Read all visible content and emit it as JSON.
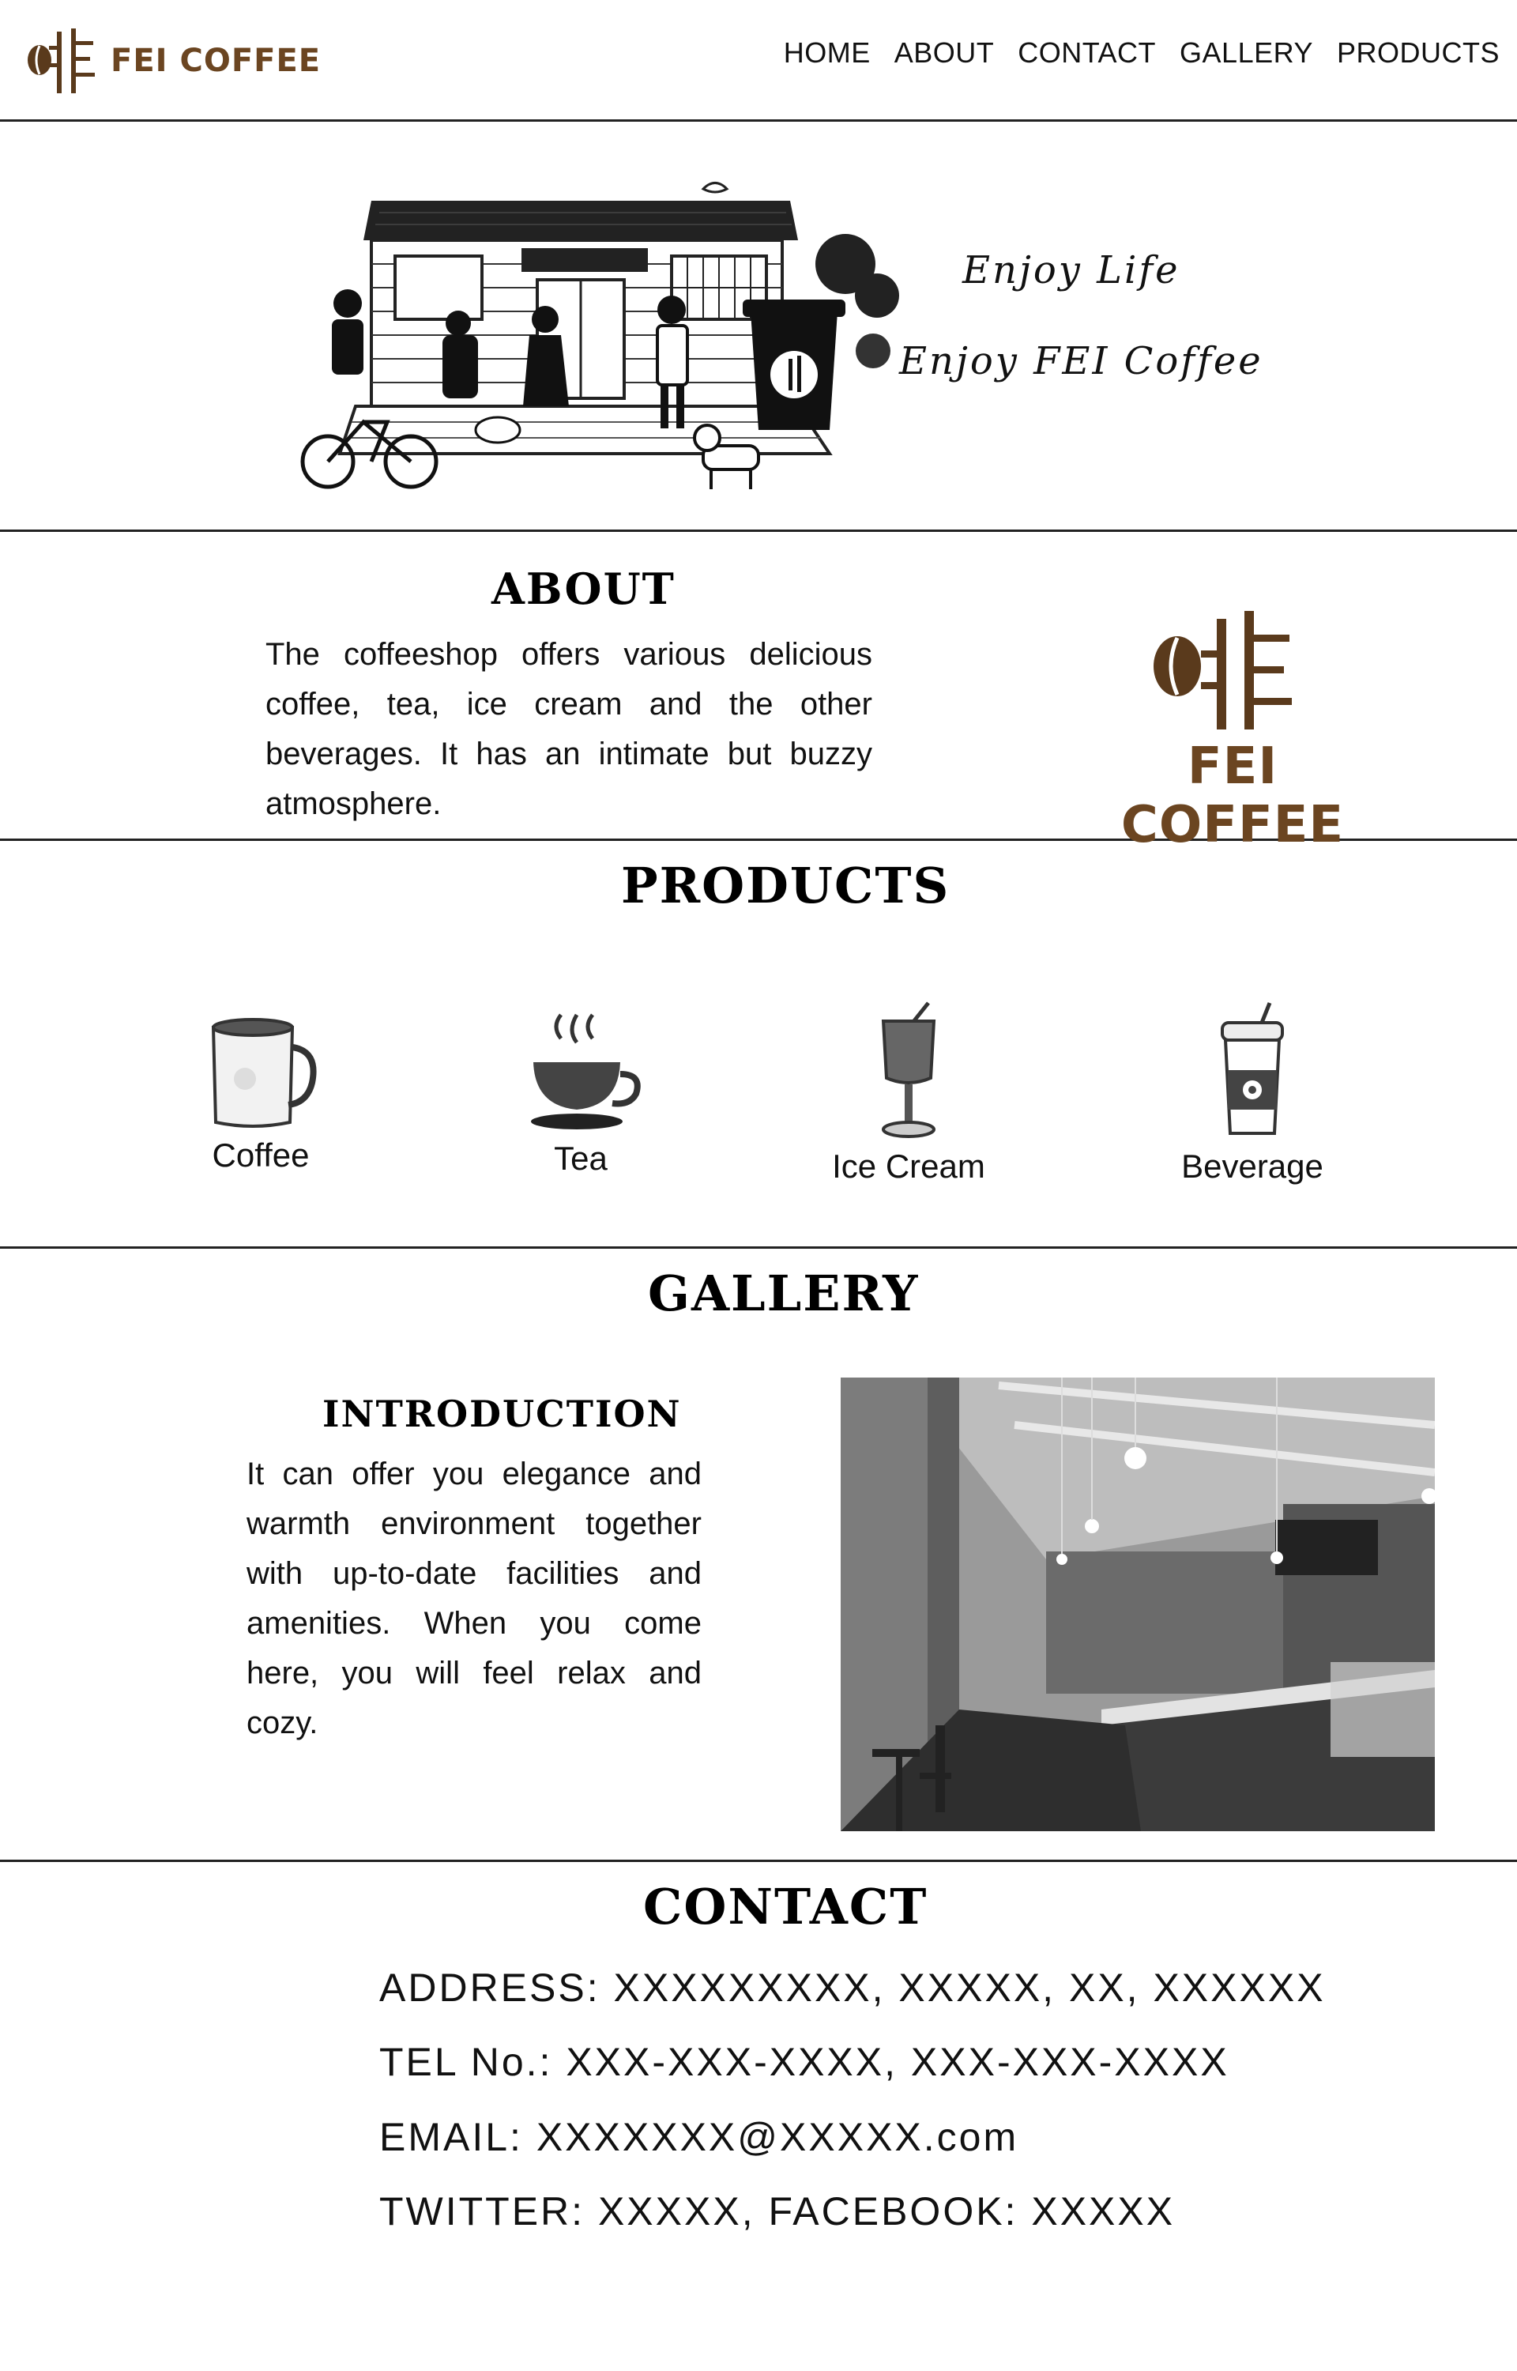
{
  "brand": {
    "name": "FEI COFFEE",
    "color": "#6b4521"
  },
  "nav": {
    "items": [
      "HOME",
      "ABOUT",
      "CONTACT",
      "GALLERY",
      "PRODUCTS"
    ]
  },
  "hero": {
    "slogans": [
      "Enjoy Life",
      "Enjoy FEI Coffee"
    ]
  },
  "about": {
    "title": "ABOUT",
    "text": "The coffeeshop offers various delicious coffee, tea, ice cream and the other beverages. It has an intimate but buzzy atmosphere."
  },
  "products": {
    "title": "PRODUCTS",
    "items": [
      {
        "label": "Coffee",
        "icon": "coffee-mug-icon"
      },
      {
        "label": "Tea",
        "icon": "tea-cup-icon"
      },
      {
        "label": "Ice Cream",
        "icon": "ice-cream-glass-icon"
      },
      {
        "label": "Beverage",
        "icon": "beverage-cup-icon"
      }
    ]
  },
  "gallery": {
    "title": "GALLERY",
    "intro_title": "INTRODUCTION",
    "intro_text": "It can offer you elegance and warmth environment together with up-to-date facilities and amenities. When you come here, you will feel relax and cozy."
  },
  "contact": {
    "title": "CONTACT",
    "address": "ADDRESS: XXXXXXXXX, XXXXX, XX, XXXXXX",
    "tel": "TEL No.: XXX-XXX-XXXX, XXX-XXX-XXXX",
    "email": "EMAIL: XXXXXXX@XXXXX.com",
    "social": "TWITTER: XXXXX, FACEBOOK: XXXXX"
  }
}
